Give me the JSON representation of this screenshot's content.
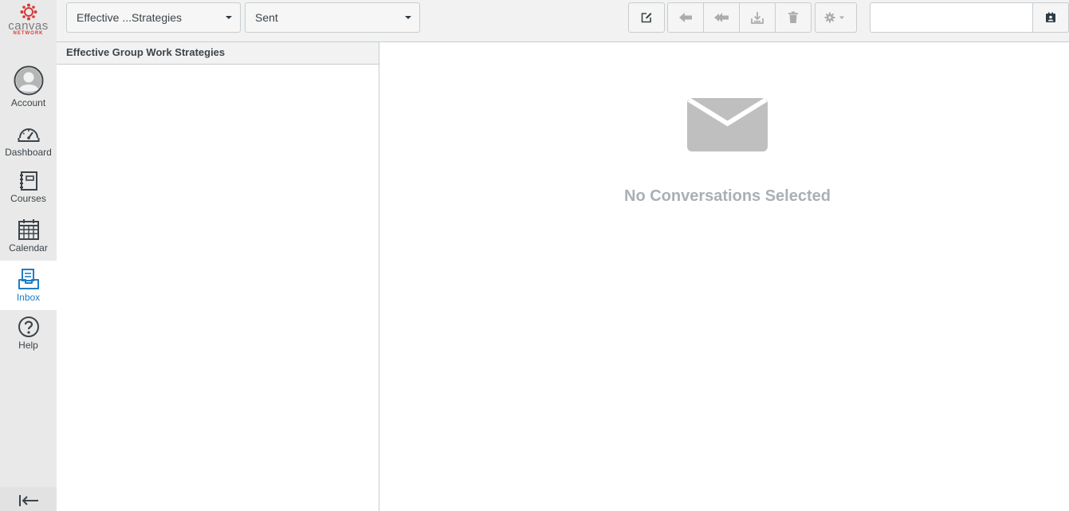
{
  "nav": {
    "logo_word": "canvas",
    "logo_sub": "NETWORK",
    "items": [
      {
        "label": "Account",
        "icon": "avatar-icon"
      },
      {
        "label": "Dashboard",
        "icon": "dashboard-icon"
      },
      {
        "label": "Courses",
        "icon": "courses-icon"
      },
      {
        "label": "Calendar",
        "icon": "calendar-icon"
      },
      {
        "label": "Inbox",
        "icon": "inbox-icon",
        "active": true
      },
      {
        "label": "Help",
        "icon": "help-icon"
      }
    ]
  },
  "toolbar": {
    "course_select": "Effective ...Strategies",
    "type_select": "Sent",
    "search_placeholder": ""
  },
  "list": {
    "header": "Effective Group Work Strategies"
  },
  "message": {
    "empty_text": "No Conversations Selected"
  },
  "colors": {
    "accent": "#1f7dc4",
    "logo_red": "#d63a3a",
    "nav_bg": "#e9e9e9"
  }
}
